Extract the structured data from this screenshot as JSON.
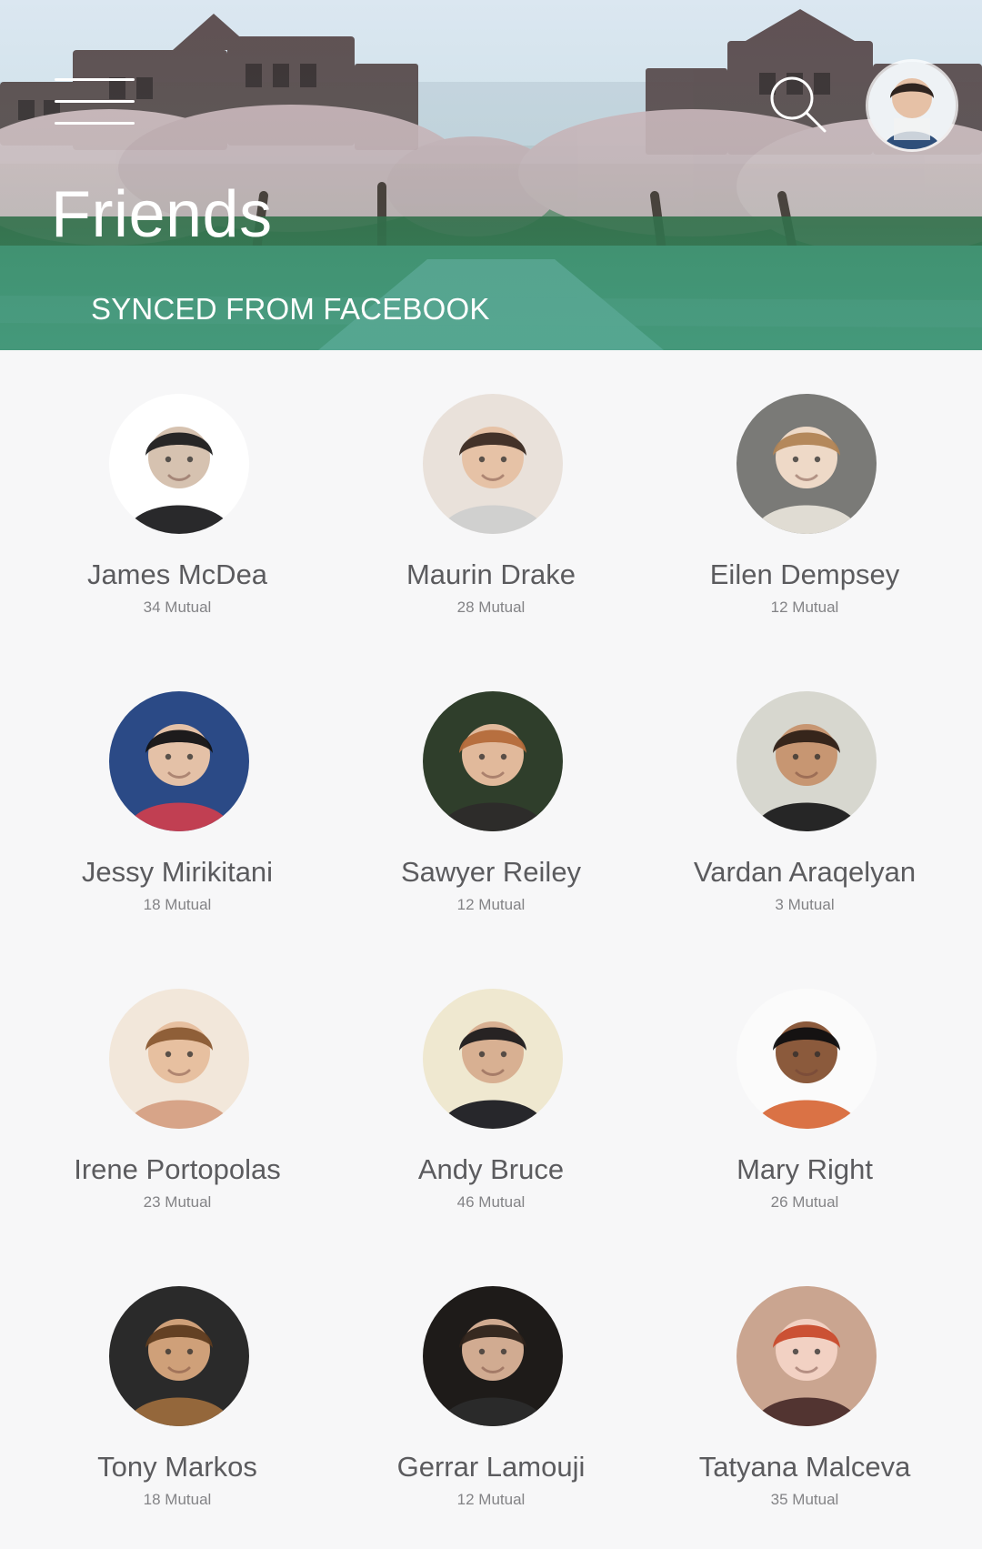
{
  "header": {
    "title": "Friends",
    "subtitle": "SYNCED FROM FACEBOOK",
    "icons": {
      "menu": "hamburger-menu-icon",
      "search": "search-icon"
    }
  },
  "friends": [
    {
      "name": "James McDea",
      "mutual": "34 Mutual",
      "colors": {
        "bg": "#ffffff",
        "skin": "#d6c2b0",
        "hair": "#1d1d1f",
        "cloth": "#1e1e20"
      }
    },
    {
      "name": "Maurin Drake",
      "mutual": "28 Mutual",
      "colors": {
        "bg": "#e9e1da",
        "skin": "#e6c2a6",
        "hair": "#3a2a22",
        "cloth": "#cfcfcf"
      }
    },
    {
      "name": "Eilen Dempsey",
      "mutual": "12 Mutual",
      "colors": {
        "bg": "#7a7a77",
        "skin": "#eed9c7",
        "hair": "#b08455",
        "cloth": "#e6e2d8"
      }
    },
    {
      "name": "Jessy Mirikitani",
      "mutual": "18 Mutual",
      "colors": {
        "bg": "#2b4a86",
        "skin": "#e4c1a7",
        "hair": "#121214",
        "cloth": "#c93e4f"
      }
    },
    {
      "name": "Sawyer Reiley",
      "mutual": "12 Mutual",
      "colors": {
        "bg": "#2f3e2b",
        "skin": "#e1b99b",
        "hair": "#b46a3a",
        "cloth": "#2d2b2a"
      }
    },
    {
      "name": "Vardan Araqelyan",
      "mutual": "3 Mutual",
      "colors": {
        "bg": "#d7d7cf",
        "skin": "#c79672",
        "hair": "#2e1f16",
        "cloth": "#1c1c1c"
      }
    },
    {
      "name": "Irene Portopolas",
      "mutual": "23 Mutual",
      "colors": {
        "bg": "#f2e7da",
        "skin": "#e7c0a0",
        "hair": "#8a5a33",
        "cloth": "#d5a084"
      }
    },
    {
      "name": "Andy Bruce",
      "mutual": "46 Mutual",
      "colors": {
        "bg": "#efe8d0",
        "skin": "#d8b092",
        "hair": "#1d1b1e",
        "cloth": "#1b1c22"
      }
    },
    {
      "name": "Mary Right",
      "mutual": "26 Mutual",
      "colors": {
        "bg": "#fbfbfb",
        "skin": "#8b5a3c",
        "hair": "#0f0f10",
        "cloth": "#d86a3b"
      }
    },
    {
      "name": "Tony Markos",
      "mutual": "18 Mutual",
      "colors": {
        "bg": "#2a2a2a",
        "skin": "#cfa079",
        "hair": "#5d3b1f",
        "cloth": "#9a6a3c"
      }
    },
    {
      "name": "Gerrar Lamouji",
      "mutual": "12 Mutual",
      "colors": {
        "bg": "#1e1b19",
        "skin": "#d1ab91",
        "hair": "#2d221a",
        "cloth": "#2b2b2b"
      }
    },
    {
      "name": "Tatyana Malceva",
      "mutual": "35 Mutual",
      "colors": {
        "bg": "#caa590",
        "skin": "#f2d1c3",
        "hair": "#c84a2c",
        "cloth": "#4b2d2c"
      }
    }
  ]
}
